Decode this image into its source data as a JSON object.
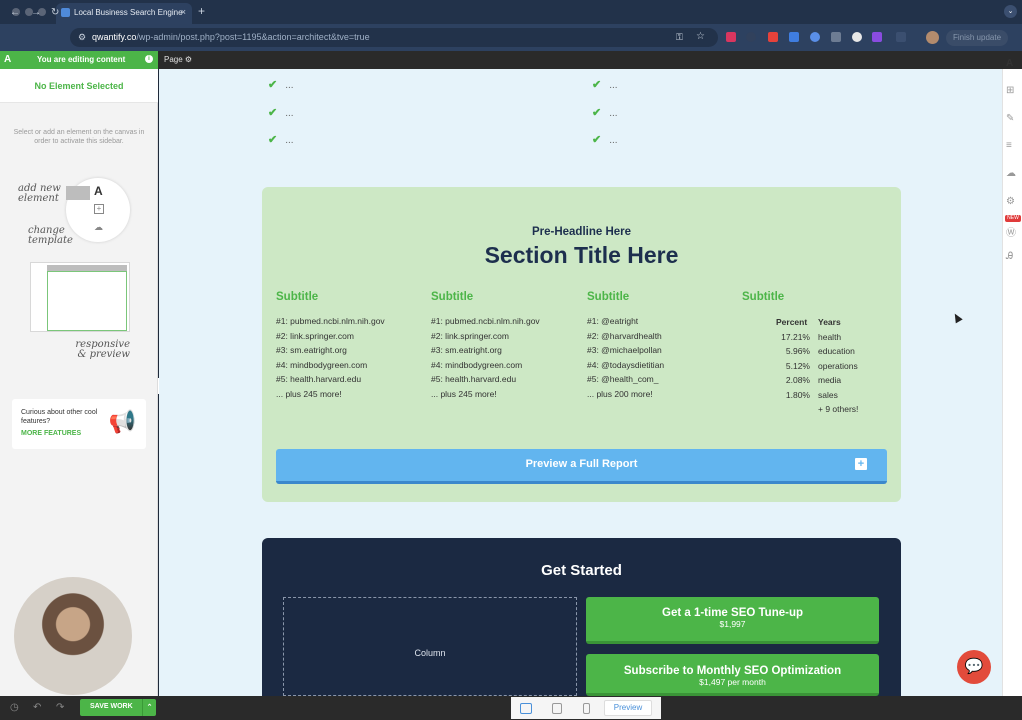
{
  "browser": {
    "tab_title": "Local Business Search Engine",
    "tab_close": "×",
    "new_tab": "+",
    "url_host": "qwantify.co",
    "url_path": "/wp-admin/post.php?post=1195&action=architect&tve=true",
    "finish_update": "Finish update",
    "tab_menu": "⌄"
  },
  "editor": {
    "editing_label": "You are editing content",
    "page_label": "Page ⚙",
    "no_element": "No Element Selected",
    "hint": "Select or add an element on the canvas in order to activate this sidebar.",
    "illus_add": "add new element",
    "illus_change": "change template",
    "illus_responsive": "responsive & preview",
    "promo_text": "Curious about other cool features?",
    "promo_link": "MORE FEATURES",
    "save_label": "SAVE WORK",
    "preview_label": "Preview",
    "new_badge": "NEW"
  },
  "canvas": {
    "check_items": [
      "...",
      "...",
      "...",
      "...",
      "...",
      "..."
    ],
    "pre_headline": "Pre-Headline Here",
    "section_title": "Section Title Here",
    "subtitles": [
      "Subtitle",
      "Subtitle",
      "Subtitle",
      "Subtitle"
    ],
    "col1": [
      "#1: pubmed.ncbi.nlm.nih.gov",
      "#2: link.springer.com",
      "#3: sm.eatright.org",
      "#4: mindbodygreen.com",
      "#5: health.harvard.edu",
      "...   plus 245 more!"
    ],
    "col2": [
      "#1: pubmed.ncbi.nlm.nih.gov",
      "#2: link.springer.com",
      "#3: sm.eatright.org",
      "#4: mindbodygreen.com",
      "#5: health.harvard.edu",
      "...   plus 245 more!"
    ],
    "col3": [
      "#1: @eatright",
      "#2: @harvardhealth",
      "#3: @michaelpollan",
      "#4: @todaysdietitian",
      "#5: @health_com_",
      "...   plus 200 more!"
    ],
    "table_header": {
      "percent": "Percent",
      "years": "Years"
    },
    "table_rows": [
      {
        "percent": "17.21%",
        "label": "health"
      },
      {
        "percent": "5.96%",
        "label": "education"
      },
      {
        "percent": "5.12%",
        "label": "operations"
      },
      {
        "percent": "2.08%",
        "label": "media"
      },
      {
        "percent": "1.80%",
        "label": "sales"
      }
    ],
    "table_more": "+ 9 others!",
    "report_button": "Preview a Full Report",
    "get_started": "Get Started",
    "column_placeholder": "Column",
    "offer1_title": "Get a 1-time SEO Tune-up",
    "offer1_price": "$1,997",
    "offer2_title": "Subscribe to Monthly SEO Optimization",
    "offer2_price": "$1,497 per month"
  }
}
